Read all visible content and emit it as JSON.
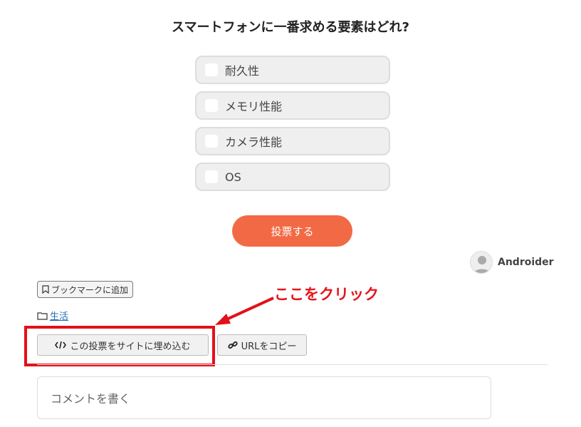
{
  "poll": {
    "question": "スマートフォンに一番求める要素はどれ?",
    "options": [
      {
        "label": "耐久性"
      },
      {
        "label": "メモリ性能"
      },
      {
        "label": "カメラ性能"
      },
      {
        "label": "OS"
      }
    ],
    "vote_label": "投票する"
  },
  "author": {
    "name": "Androider",
    "icon": "user-avatar-icon"
  },
  "actions": {
    "bookmark_label": "ブックマークに追加",
    "category_label": "生活",
    "embed_label": "この投票をサイトに埋め込む",
    "copy_url_label": "URLをコピー"
  },
  "annotation": {
    "text": "ここをクリック",
    "color": "#e8141b"
  },
  "comment": {
    "placeholder": "コメントを書く"
  },
  "colors": {
    "accent": "#f26a45",
    "link": "#2a6bb5",
    "highlight": "#e31019"
  }
}
